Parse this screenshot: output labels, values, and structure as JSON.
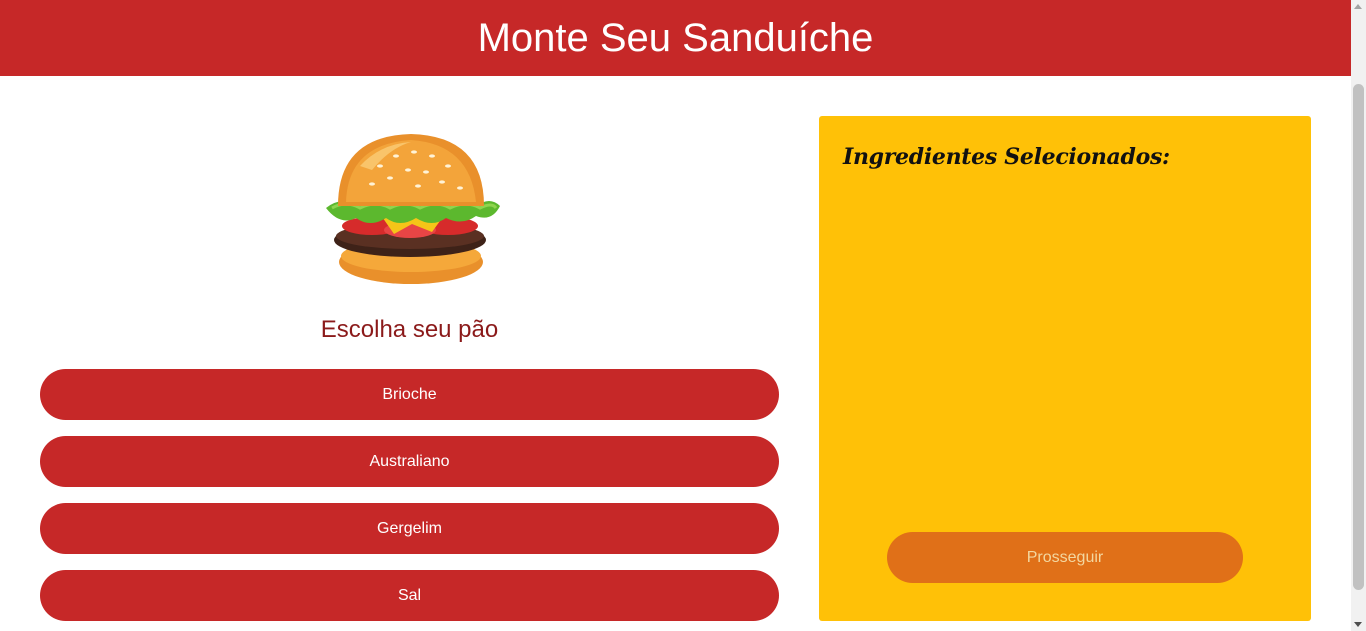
{
  "header": {
    "title": "Monte Seu Sanduíche"
  },
  "main": {
    "image_icon": "burger-icon",
    "subtitle": "Escolha seu pão",
    "bread_options": [
      "Brioche",
      "Australiano",
      "Gergelim",
      "Sal"
    ]
  },
  "panel": {
    "title": "Ingredientes Selecionados:",
    "selected_ingredients": [],
    "proceed_label": "Prosseguir"
  },
  "colors": {
    "header": "#c62828",
    "button": "#c62828",
    "panel": "#ffc107",
    "proceed": "#e07018",
    "subtitle": "#8b1a1a"
  }
}
